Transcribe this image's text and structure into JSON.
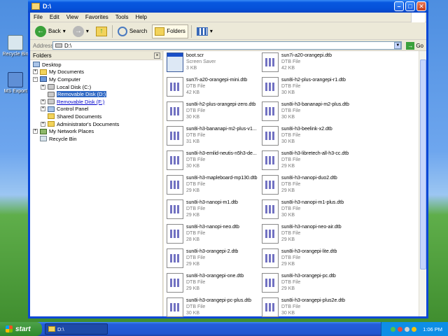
{
  "desktop": {
    "icons": [
      {
        "label": "Recycle Bin",
        "icon": "recycle-bin-icon"
      },
      {
        "label": "MS Export",
        "icon": "ms-export-icon"
      }
    ]
  },
  "window": {
    "title": "D:\\",
    "menu": [
      "File",
      "Edit",
      "View",
      "Favorites",
      "Tools",
      "Help"
    ],
    "toolbar": {
      "back": "Back",
      "search": "Search",
      "folders": "Folders"
    },
    "address": {
      "label": "Address",
      "value": "D:\\",
      "go": "Go"
    },
    "folders_pane": {
      "title": "Folders",
      "tree": [
        {
          "label": "Desktop",
          "icon": "desktop-icon"
        },
        {
          "label": "My Documents",
          "icon": "folder-icon"
        },
        {
          "label": "My Computer",
          "icon": "computer-icon"
        },
        {
          "label": "Local Disk (C:)",
          "icon": "drive-icon"
        },
        {
          "label": "Removable Disk (D:)",
          "icon": "removable-drive-icon"
        },
        {
          "label": "Removable Disk (F:)",
          "icon": "removable-drive-icon"
        },
        {
          "label": "Control Panel",
          "icon": "control-panel-icon"
        },
        {
          "label": "Shared Documents",
          "icon": "folder-icon"
        },
        {
          "label": "Administrator's Documents",
          "icon": "folder-icon"
        },
        {
          "label": "My Network Places",
          "icon": "network-icon"
        },
        {
          "label": "Recycle Bin",
          "icon": "recycle-bin-icon"
        }
      ]
    },
    "files": [
      {
        "name": "boot.scr",
        "type": "Screen Saver",
        "size": "3 KB"
      },
      {
        "name": "sun7i-a20-orangepi.dtb",
        "type": "DTB File",
        "size": "42 KB"
      },
      {
        "name": "sun7i-a20-orangepi-mini.dtb",
        "type": "DTB File",
        "size": "42 KB"
      },
      {
        "name": "sun8i-h2-plus-orangepi-r1.dtb",
        "type": "DTB File",
        "size": "30 KB"
      },
      {
        "name": "sun8i-h2-plus-orangepi-zero.dtb",
        "type": "DTB File",
        "size": "30 KB"
      },
      {
        "name": "sun8i-h3-bananapi-m2-plus.dtb",
        "type": "DTB File",
        "size": "30 KB"
      },
      {
        "name": "sun8i-h3-bananapi-m2-plus-v1...",
        "type": "DTB File",
        "size": "31 KB"
      },
      {
        "name": "sun8i-h3-beelink-x2.dtb",
        "type": "DTB File",
        "size": "30 KB"
      },
      {
        "name": "sun8i-h3-emlid-neutis-n5h3-de...",
        "type": "DTB File",
        "size": "30 KB"
      },
      {
        "name": "sun8i-h3-libretech-all-h3-cc.dtb",
        "type": "DTB File",
        "size": "29 KB"
      },
      {
        "name": "sun8i-h3-mapleboard-mp130.dtb",
        "type": "DTB File",
        "size": "29 KB"
      },
      {
        "name": "sun8i-h3-nanopi-duo2.dtb",
        "type": "DTB File",
        "size": "29 KB"
      },
      {
        "name": "sun8i-h3-nanopi-m1.dtb",
        "type": "DTB File",
        "size": "29 KB"
      },
      {
        "name": "sun8i-h3-nanopi-m1-plus.dtb",
        "type": "DTB File",
        "size": "30 KB"
      },
      {
        "name": "sun8i-h3-nanopi-neo.dtb",
        "type": "DTB File",
        "size": "28 KB"
      },
      {
        "name": "sun8i-h3-nanopi-neo-air.dtb",
        "type": "DTB File",
        "size": "29 KB"
      },
      {
        "name": "sun8i-h3-orangepi-2.dtb",
        "type": "DTB File",
        "size": "29 KB"
      },
      {
        "name": "sun8i-h3-orangepi-lite.dtb",
        "type": "DTB File",
        "size": "29 KB"
      },
      {
        "name": "sun8i-h3-orangepi-one.dtb",
        "type": "DTB File",
        "size": "29 KB"
      },
      {
        "name": "sun8i-h3-orangepi-pc.dtb",
        "type": "DTB File",
        "size": "29 KB"
      },
      {
        "name": "sun8i-h3-orangepi-pc-plus.dtb",
        "type": "DTB File",
        "size": "30 KB"
      },
      {
        "name": "sun8i-h3-orangepi-plus2e.dtb",
        "type": "DTB File",
        "size": "30 KB"
      }
    ]
  },
  "taskbar": {
    "start": "start",
    "task": "D:\\",
    "clock": "1:06 PM"
  },
  "colors": {
    "selection": "#316ac5",
    "titlebar": "#0858e0",
    "taskbar": "#245edb",
    "start": "#2d8a2a"
  }
}
